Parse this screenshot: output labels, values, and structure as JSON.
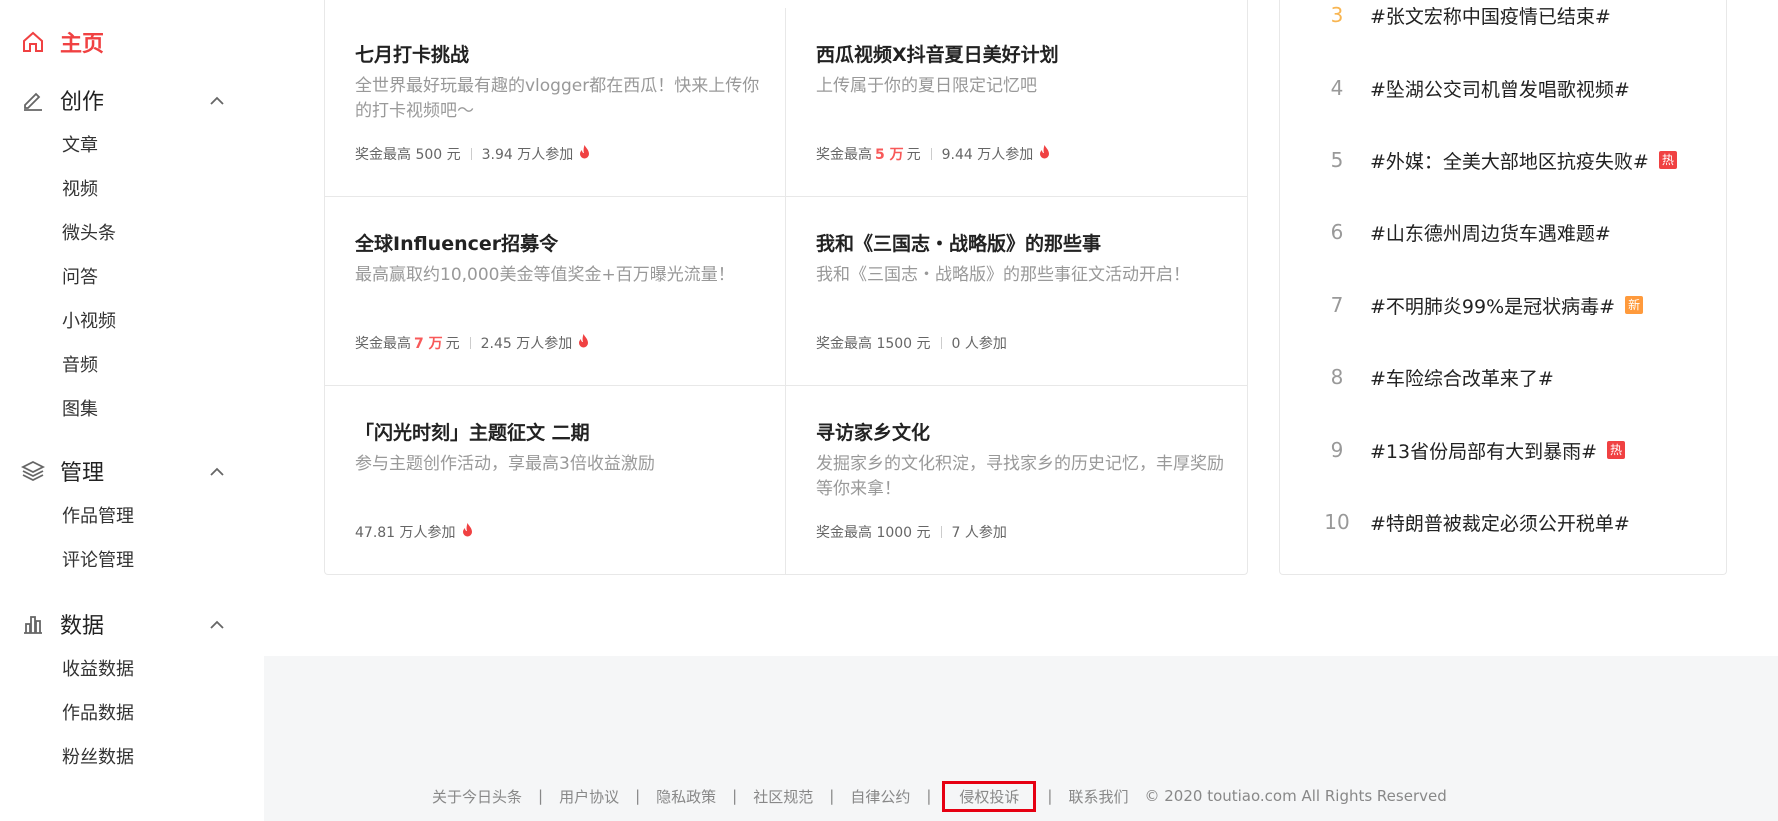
{
  "sidebar": {
    "home": "主页",
    "sections": [
      {
        "label": "创作",
        "items": [
          "文章",
          "视频",
          "微头条",
          "问答",
          "小视频",
          "音频",
          "图集"
        ]
      },
      {
        "label": "管理",
        "items": [
          "作品管理",
          "评论管理"
        ]
      },
      {
        "label": "数据",
        "items": [
          "收益数据",
          "作品数据",
          "粉丝数据"
        ]
      }
    ]
  },
  "challenges": [
    {
      "title": "七月打卡挑战",
      "desc": "全世界最好玩最有趣的vlogger都在西瓜！快来上传你的打卡视频吧～",
      "prize_prefix": "奖金最高 500 元",
      "prize_amount": "",
      "prize_unit": "",
      "participants": "3.94 万人参加",
      "hot": true
    },
    {
      "title": "西瓜视频X抖音夏日美好计划",
      "desc": "上传属于你的夏日限定记忆吧",
      "prize_prefix": "奖金最高",
      "prize_amount": "5 万",
      "prize_unit": "元",
      "participants": "9.44 万人参加",
      "hot": true
    },
    {
      "title": "全球Influencer招募令",
      "desc": "最高赢取约10,000美金等值奖金+百万曝光流量！",
      "prize_prefix": "奖金最高",
      "prize_amount": "7 万",
      "prize_unit": "元",
      "participants": "2.45 万人参加",
      "hot": true
    },
    {
      "title": "我和《三国志・战略版》的那些事",
      "desc": "我和《三国志・战略版》的那些事征文活动开启！",
      "prize_prefix": "奖金最高 1500 元",
      "prize_amount": "",
      "prize_unit": "",
      "participants": "0 人参加",
      "hot": false
    },
    {
      "title": "「闪光时刻」主题征文 二期",
      "desc": "参与主题创作活动，享最高3倍收益激励",
      "prize_prefix": "",
      "prize_amount": "",
      "prize_unit": "",
      "participants": "47.81 万人参加",
      "hot": true
    },
    {
      "title": "寻访家乡文化",
      "desc": "发掘家乡的文化积淀，寻找家乡的历史记忆，丰厚奖励等你来拿！",
      "prize_prefix": "奖金最高 1000 元",
      "prize_amount": "",
      "prize_unit": "",
      "participants": "7 人参加",
      "hot": false
    }
  ],
  "hot_topics": [
    {
      "rank": "3",
      "topic": "#张文宏称中国疫情已结束#",
      "tag": ""
    },
    {
      "rank": "4",
      "topic": "#坠湖公交司机曾发唱歌视频#",
      "tag": ""
    },
    {
      "rank": "5",
      "topic": "#外媒：全美大部地区抗疫失败#",
      "tag": "热"
    },
    {
      "rank": "6",
      "topic": "#山东德州周边货车遇难题#",
      "tag": ""
    },
    {
      "rank": "7",
      "topic": "#不明肺炎99%是冠状病毒#",
      "tag": "新"
    },
    {
      "rank": "8",
      "topic": "#车险综合改革来了#",
      "tag": ""
    },
    {
      "rank": "9",
      "topic": "#13省份局部有大到暴雨#",
      "tag": "热"
    },
    {
      "rank": "10",
      "topic": "#特朗普被裁定必须公开税单#",
      "tag": ""
    }
  ],
  "footer": {
    "links": [
      "关于今日头条",
      "用户协议",
      "隐私政策",
      "社区规范",
      "自律公约",
      "侵权投诉",
      "联系我们"
    ],
    "copyright": "© 2020 toutiao.com All Rights Reserved"
  },
  "colors": {
    "accent": "#f04142",
    "gold": "#f8b551",
    "hot_tag": "#f04142",
    "new_tag": "#ff9a3c",
    "highlight_box": "#e60012"
  }
}
